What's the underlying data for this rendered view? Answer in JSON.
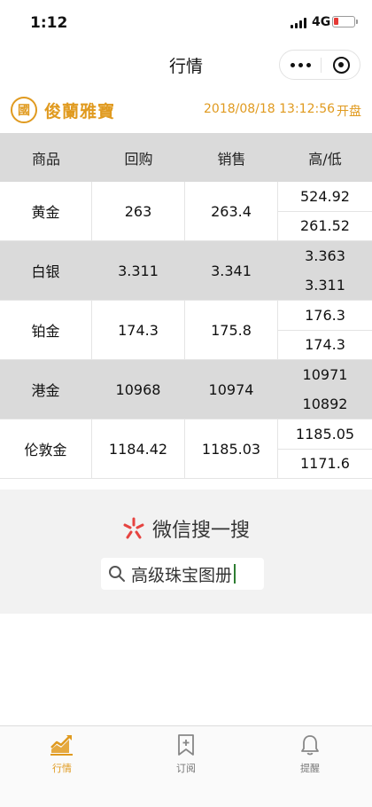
{
  "status": {
    "time": "1:12",
    "network": "4G"
  },
  "nav": {
    "title": "行情"
  },
  "header": {
    "logo_seal": "國",
    "brand": "俊蘭雅寶",
    "datetime": "2018/08/18 13:12:56",
    "market_status": "开盘"
  },
  "table": {
    "headers": [
      "商品",
      "回购",
      "销售",
      "高/低"
    ],
    "rows": [
      {
        "name": "黄金",
        "buy": "263",
        "sell": "263.4",
        "high": "524.92",
        "low": "261.52"
      },
      {
        "name": "白银",
        "buy": "3.311",
        "sell": "3.341",
        "high": "3.363",
        "low": "3.311"
      },
      {
        "name": "铂金",
        "buy": "174.3",
        "sell": "175.8",
        "high": "176.3",
        "low": "174.3"
      },
      {
        "name": "港金",
        "buy": "10968",
        "sell": "10974",
        "high": "10971",
        "low": "10892"
      },
      {
        "name": "伦敦金",
        "buy": "1184.42",
        "sell": "1185.03",
        "high": "1185.05",
        "low": "1171.6"
      }
    ]
  },
  "wechat_search": {
    "brand": "微信搜一搜",
    "query": "高级珠宝图册"
  },
  "tabbar": [
    {
      "label": "行情",
      "icon": "chart-trend-icon",
      "active": true
    },
    {
      "label": "订阅",
      "icon": "bookmark-add-icon",
      "active": false
    },
    {
      "label": "提醒",
      "icon": "bell-icon",
      "active": false
    }
  ],
  "colors": {
    "accent": "#e09a1f",
    "row_alt": "#dadada",
    "search_bg": "#f2f2f2"
  }
}
